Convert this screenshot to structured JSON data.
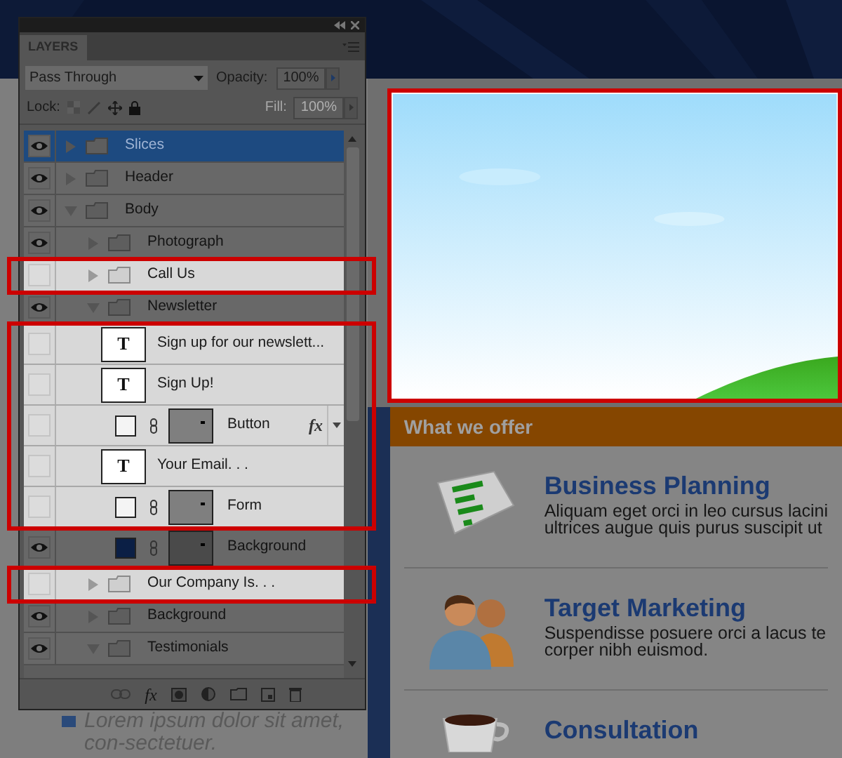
{
  "panel": {
    "tab": "LAYERS",
    "blend_mode": "Pass Through",
    "opacity_label": "Opacity:",
    "opacity": "100%",
    "lock_label": "Lock:",
    "fill_label": "Fill:",
    "fill": "100%",
    "fill_disabled": true,
    "footer_fx": "fx",
    "layers": [
      {
        "kind": "folder",
        "name": "Slices",
        "visible": true,
        "selected": true,
        "highlighted": false,
        "expanded": false
      },
      {
        "kind": "folder",
        "name": "Header",
        "visible": true,
        "selected": false,
        "highlighted": false,
        "expanded": false
      },
      {
        "kind": "folder",
        "name": "Body",
        "visible": true,
        "selected": false,
        "highlighted": false,
        "expanded": true,
        "children": [
          {
            "kind": "folder",
            "name": "Photograph",
            "visible": true,
            "selected": false,
            "highlighted": false,
            "expanded": false
          },
          {
            "kind": "folder",
            "name": "Call Us",
            "visible": false,
            "selected": false,
            "highlighted": true,
            "expanded": false
          },
          {
            "kind": "folder",
            "name": "Newsletter",
            "visible": true,
            "selected": false,
            "highlighted": false,
            "expanded": true,
            "children": [
              {
                "kind": "text",
                "name": "Sign up for our newslett...",
                "thumb": "T",
                "visible": false,
                "selected": false,
                "highlighted": true
              },
              {
                "kind": "text",
                "name": "Sign Up!",
                "thumb": "T",
                "visible": false,
                "selected": false,
                "highlighted": true
              },
              {
                "kind": "shape",
                "name": "Button",
                "color": "#f4f4f4",
                "effects": "fx",
                "visible": false,
                "selected": false,
                "highlighted": true
              },
              {
                "kind": "text",
                "name": "Your Email. . .",
                "thumb": "T",
                "visible": false,
                "selected": false,
                "highlighted": true
              },
              {
                "kind": "shape",
                "name": "Form",
                "color": "#f4f4f4",
                "visible": false,
                "selected": false,
                "highlighted": true
              },
              {
                "kind": "shape",
                "name": "Background",
                "color": "#0b1f45",
                "visible": true,
                "selected": false,
                "highlighted": false
              }
            ]
          },
          {
            "kind": "folder",
            "name": "Our Company Is. . .",
            "visible": false,
            "selected": false,
            "highlighted": true,
            "expanded": false
          },
          {
            "kind": "folder",
            "name": "Background",
            "visible": true,
            "selected": false,
            "highlighted": false,
            "expanded": false
          },
          {
            "kind": "folder",
            "name": "Testimonials",
            "visible": true,
            "selected": false,
            "highlighted": false,
            "expanded": true
          }
        ]
      }
    ]
  },
  "page": {
    "hero": {
      "kind": "picture",
      "highlighted": true
    },
    "offer_heading": "What we offer",
    "services": [
      {
        "kind": "chart",
        "title": "Business Planning",
        "lines": [
          "Aliquam eget orci in leo cursus lacini",
          "ultrices augue quis purus suscipit ut"
        ]
      },
      {
        "kind": "people",
        "title": "Target Marketing",
        "lines": [
          "Suspendisse posuere orci a lacus te",
          "corper nibh euismod."
        ]
      },
      {
        "kind": "cup",
        "title": "Consultation"
      }
    ],
    "list_item": "Lorem ipsum dolor sit amet, con-sectetuer."
  }
}
